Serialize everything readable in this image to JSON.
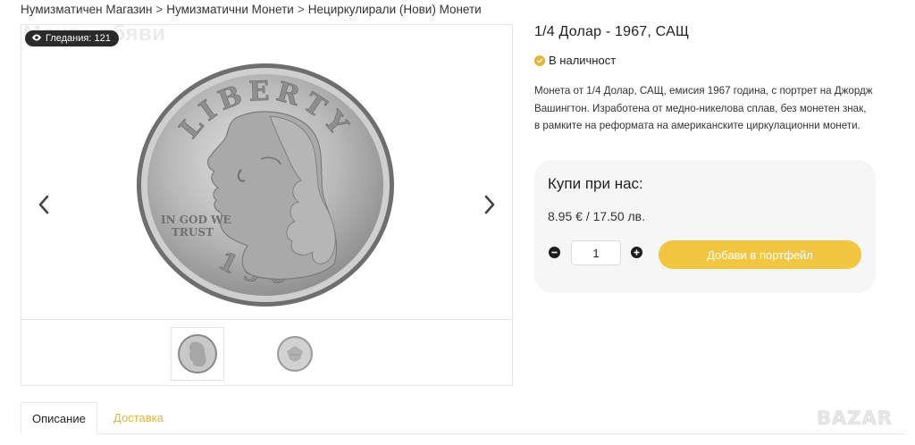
{
  "breadcrumb": {
    "items": [
      "Нумизматичен Магазин",
      "Нумизматични Монети",
      "Нециркулирали (Нови) Монети"
    ],
    "separator": ">"
  },
  "gallery": {
    "watermark": "Моите обяви",
    "views_label": "Гледания: 121",
    "coin": {
      "legend_top": "LIBERTY",
      "motto": [
        "IN GOD WE",
        "TRUST"
      ],
      "year": "1967"
    },
    "prev_icon": "chevron-left-icon",
    "next_icon": "chevron-right-icon",
    "thumbnails": [
      "coin-obverse-thumb",
      "coin-reverse-thumb"
    ]
  },
  "product": {
    "title": "1/4 Долар - 1967, САЩ",
    "stock": "В наличност",
    "description": "Монета от 1/4 Долар, САЩ, емисия 1967 година, с портрет на Джордж Вашингтон. Изработена от медно-никелова сплав, без монетен знак, в рамките на реформата на американските циркулационни монети."
  },
  "buy_box": {
    "title": "Купи при нас:",
    "price": "8.95 € / 17.50 лв.",
    "quantity": "1",
    "add_to_cart": "Добави в портфейл"
  },
  "tabs": [
    {
      "label": "Описание",
      "active": true
    },
    {
      "label": "Доставка",
      "active": false
    }
  ],
  "logo": {
    "text": "BAZAR"
  },
  "colors": {
    "accent": "#f2c641",
    "stock_badge": "#e5b53a",
    "badge_bg": "#2b2b2b",
    "coin_silver": "#a8a8a8"
  }
}
